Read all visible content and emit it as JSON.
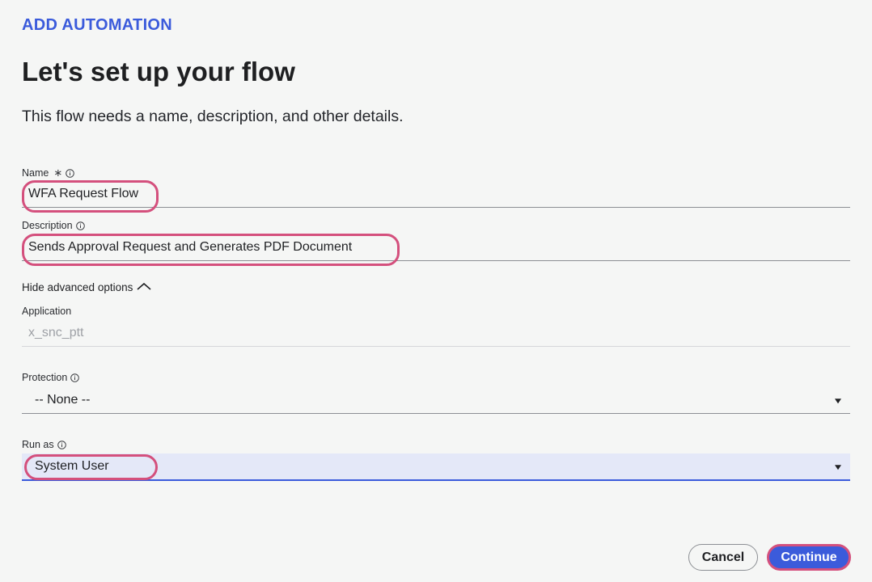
{
  "header": {
    "eyebrow": "ADD AUTOMATION",
    "title": "Let's set up your flow",
    "subtitle": "This flow needs a name, description, and other details."
  },
  "form": {
    "name": {
      "label": "Name",
      "required_mark": "∗",
      "value": "WFA Request Flow"
    },
    "description": {
      "label": "Description",
      "value": "Sends Approval Request and Generates PDF Document"
    },
    "advanced_toggle": "Hide advanced options",
    "application": {
      "label": "Application",
      "value": "x_snc_ptt"
    },
    "protection": {
      "label": "Protection",
      "value": "-- None --"
    },
    "run_as": {
      "label": "Run as",
      "value": "System User"
    }
  },
  "footer": {
    "cancel_label": "Cancel",
    "continue_label": "Continue"
  },
  "colors": {
    "accent": "#3b5bdb",
    "highlight": "#d4507d",
    "background": "#f5f6f5",
    "active_field": "#e4e8f8"
  },
  "icons": [
    "info-icon",
    "chevron-up-icon",
    "caret-down-icon"
  ]
}
